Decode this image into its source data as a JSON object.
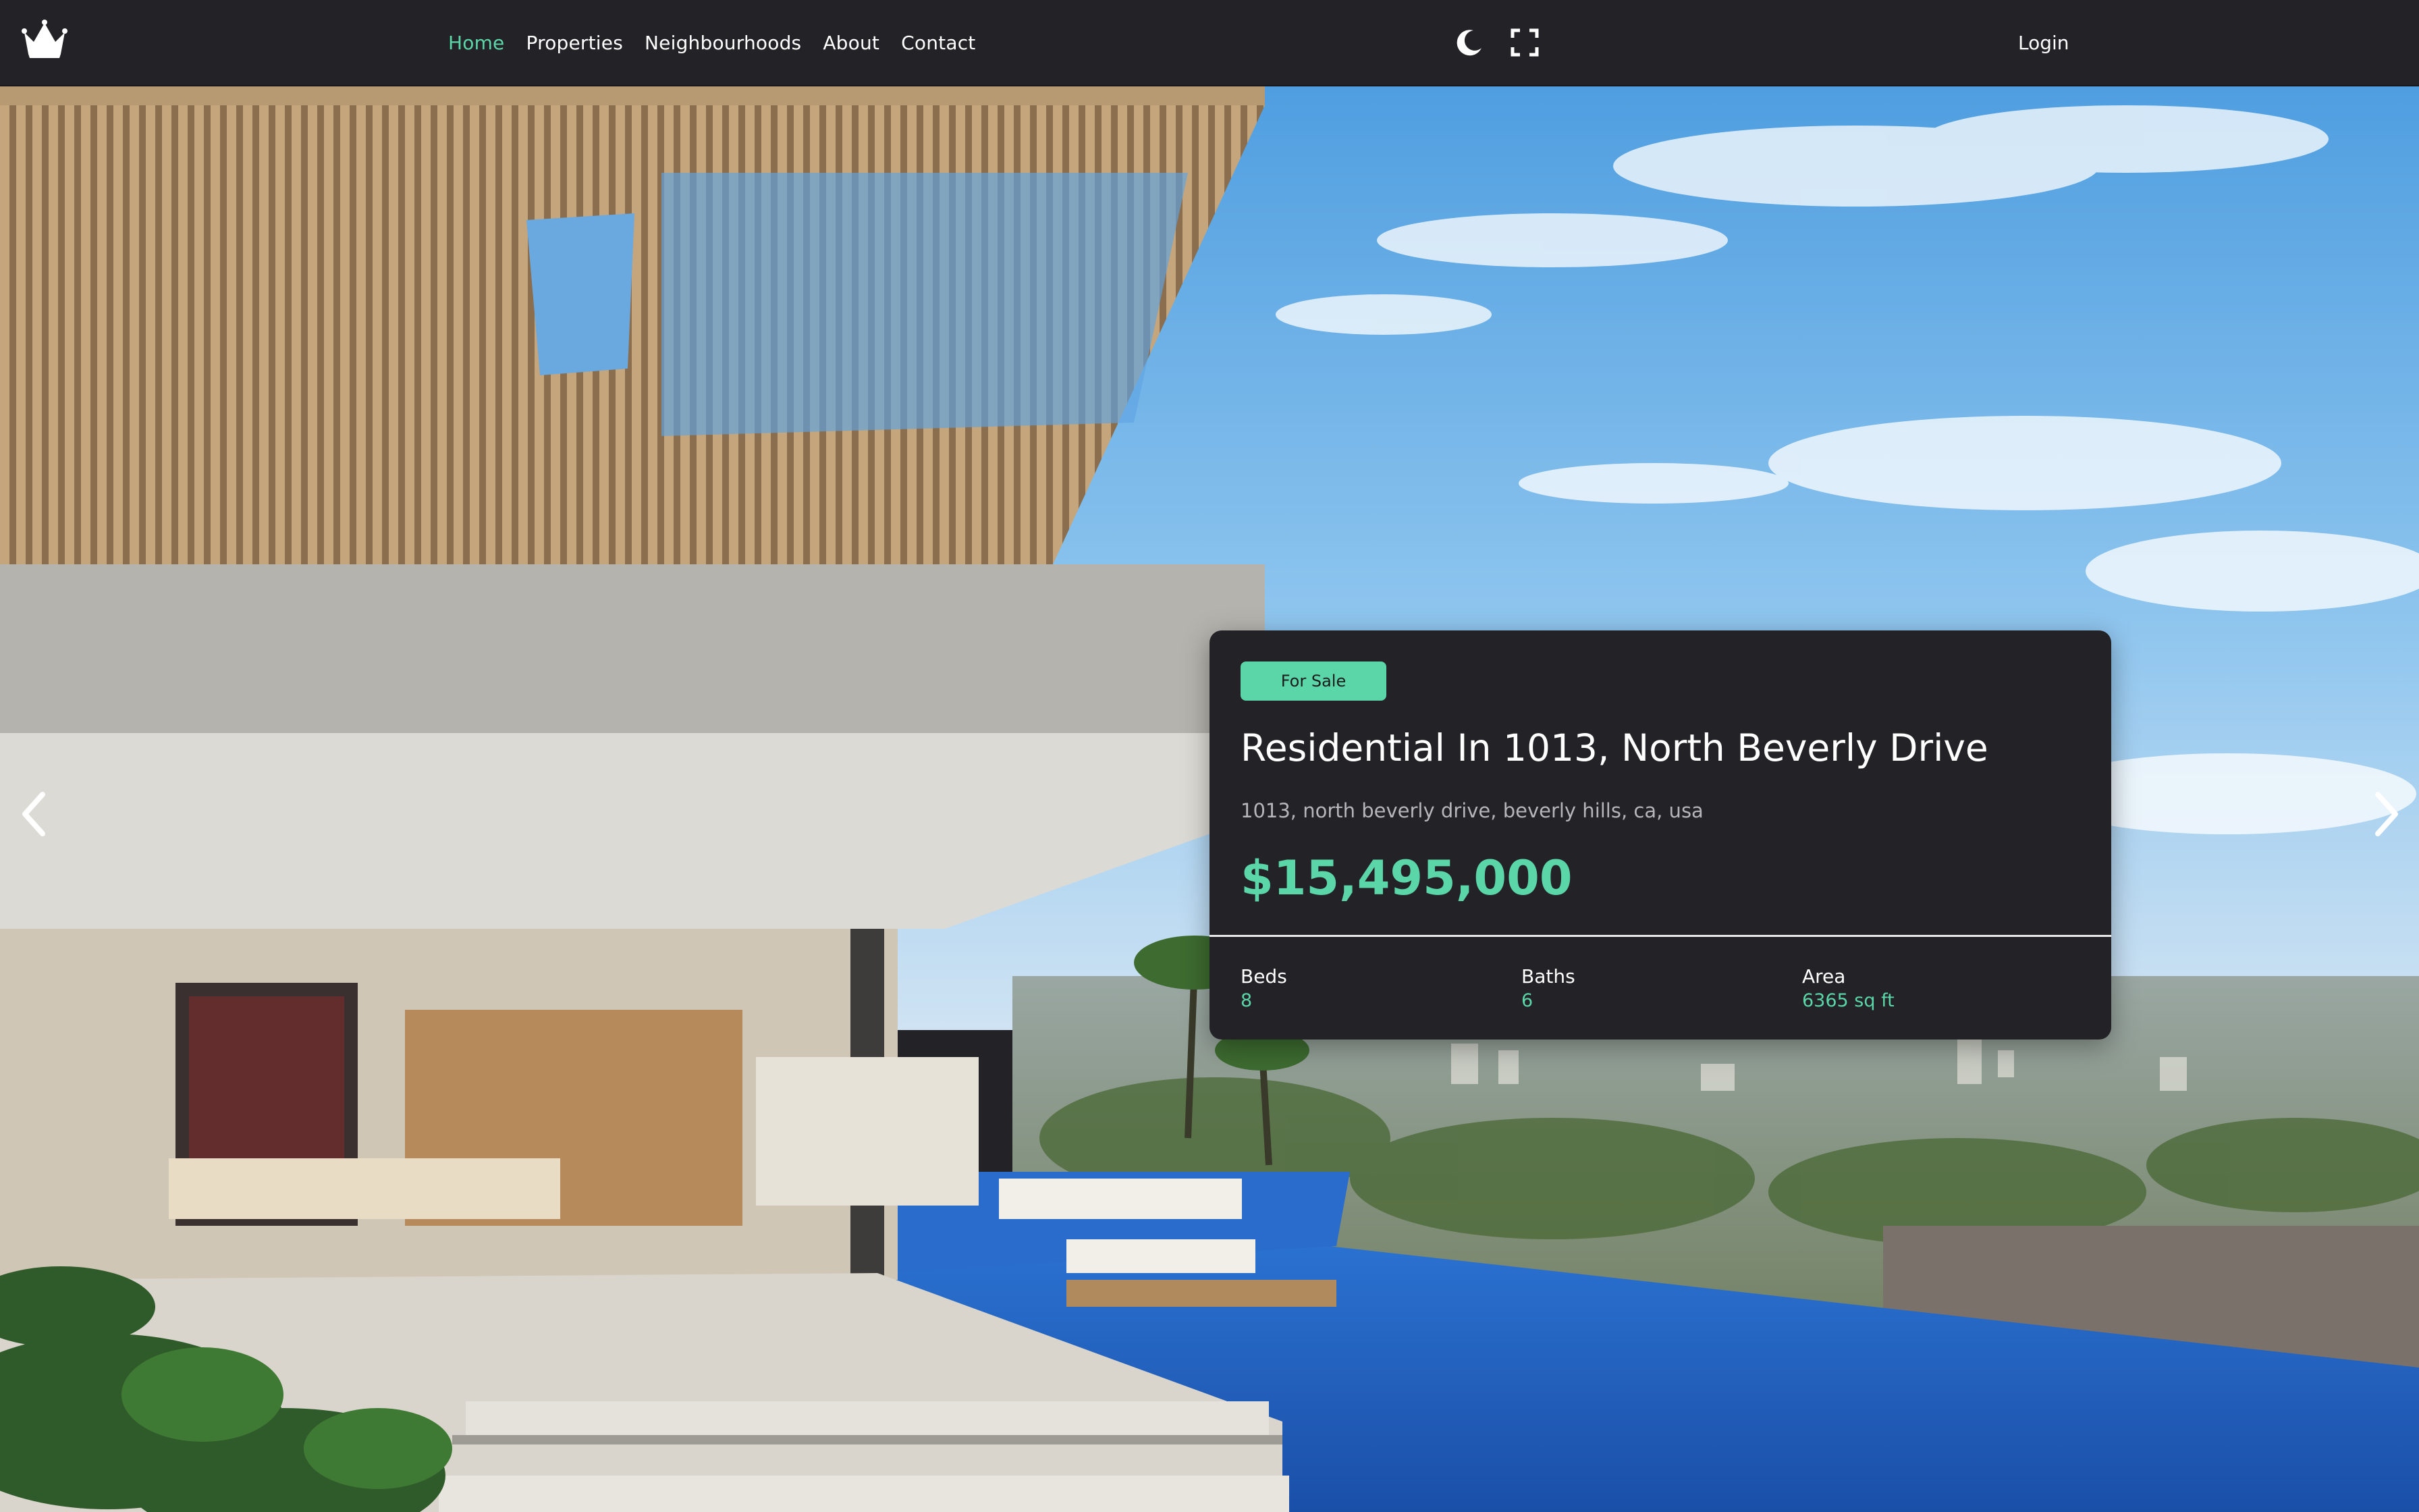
{
  "nav": {
    "items": [
      {
        "label": "Home",
        "active": true
      },
      {
        "label": "Properties",
        "active": false
      },
      {
        "label": "Neighbourhoods",
        "active": false
      },
      {
        "label": "About",
        "active": false
      },
      {
        "label": "Contact",
        "active": false
      }
    ],
    "login_label": "Login",
    "icons": [
      "crown-logo-icon",
      "moon-icon",
      "fullscreen-icon"
    ]
  },
  "hero": {
    "image_icon": "property-hero-photo",
    "prev_icon": "chevron-left-icon",
    "next_icon": "chevron-right-icon"
  },
  "listing": {
    "status_badge": "For Sale",
    "title": "Residential In 1013, North Beverly Drive",
    "address": "1013, north beverly drive, beverly hills, ca, usa",
    "price": "$15,495,000",
    "stats": [
      {
        "label": "Beds",
        "value": "8"
      },
      {
        "label": "Baths",
        "value": "6"
      },
      {
        "label": "Area",
        "value": "6365 sq ft"
      }
    ]
  },
  "colors": {
    "accent": "#5bd6a8",
    "background": "#232226",
    "text": "#ffffff",
    "muted_text": "#b6b6ba"
  }
}
